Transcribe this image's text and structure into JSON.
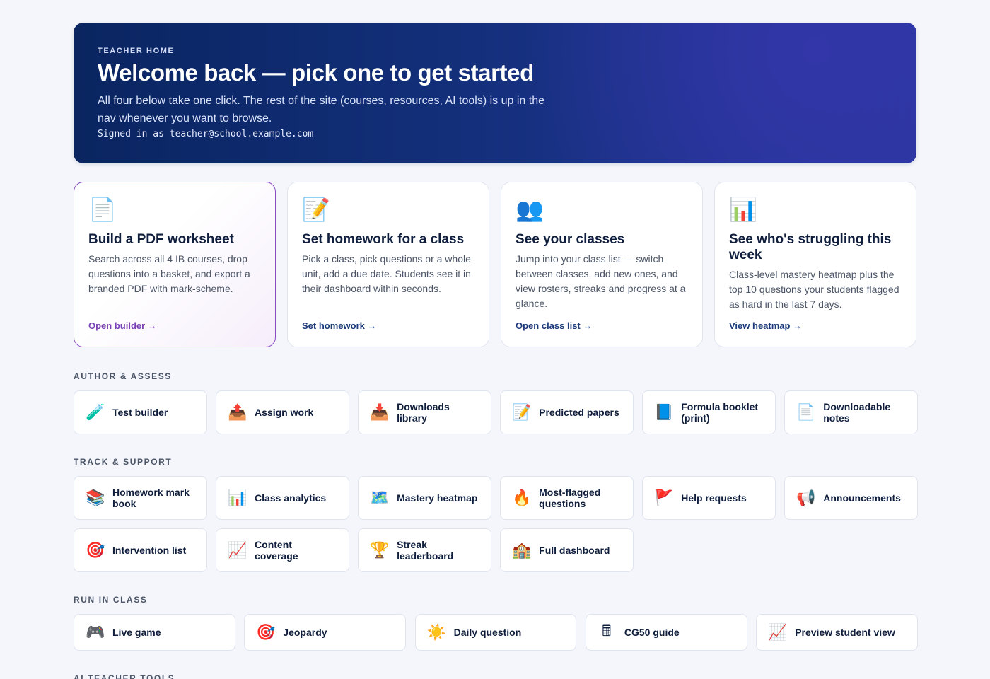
{
  "hero": {
    "eyebrow": "TEACHER HOME",
    "title": "Welcome back — pick one to get started",
    "subtitle": "All four below take one click. The rest of the site (courses, resources, AI tools) is up in the nav whenever you want to browse.",
    "signed_in": "Signed in as teacher@school.example.com"
  },
  "cards": [
    {
      "icon": "📄",
      "title": "Build a PDF worksheet",
      "desc": "Search across all 4 IB courses, drop questions into a basket, and export a branded PDF with mark-scheme.",
      "cta": "Open builder →"
    },
    {
      "icon": "📝",
      "title": "Set homework for a class",
      "desc": "Pick a class, pick questions or a whole unit, add a due date. Students see it in their dashboard within seconds.",
      "cta": "Set homework →"
    },
    {
      "icon": "👥",
      "title": "See your classes",
      "desc": "Jump into your class list — switch between classes, add new ones, and view rosters, streaks and progress at a glance.",
      "cta": "Open class list →"
    },
    {
      "icon": "📊",
      "title": "See who's struggling this week",
      "desc": "Class-level mastery heatmap plus the top 10 questions your students flagged as hard in the last 7 days.",
      "cta": "View heatmap →"
    }
  ],
  "sections": {
    "author": {
      "label": "AUTHOR & ASSESS",
      "items": [
        {
          "icon": "🧪",
          "label": "Test builder"
        },
        {
          "icon": "📤",
          "label": "Assign work"
        },
        {
          "icon": "📥",
          "label": "Downloads library"
        },
        {
          "icon": "📝",
          "label": "Predicted papers"
        },
        {
          "icon": "📘",
          "label": "Formula booklet (print)"
        },
        {
          "icon": "📄",
          "label": "Downloadable notes"
        }
      ]
    },
    "track": {
      "label": "TRACK & SUPPORT",
      "items": [
        {
          "icon": "📚",
          "label": "Homework mark book"
        },
        {
          "icon": "📊",
          "label": "Class analytics"
        },
        {
          "icon": "🗺️",
          "label": "Mastery heatmap"
        },
        {
          "icon": "🔥",
          "label": "Most-flagged questions"
        },
        {
          "icon": "🚩",
          "label": "Help requests"
        },
        {
          "icon": "📢",
          "label": "Announcements"
        },
        {
          "icon": "🎯",
          "label": "Intervention list"
        },
        {
          "icon": "📈",
          "label": "Content coverage"
        },
        {
          "icon": "🏆",
          "label": "Streak leaderboard"
        },
        {
          "icon": "🏫",
          "label": "Full dashboard"
        }
      ]
    },
    "run": {
      "label": "RUN IN CLASS",
      "items": [
        {
          "icon": "🎮",
          "label": "Live game"
        },
        {
          "icon": "🎯",
          "label": "Jeopardy"
        },
        {
          "icon": "☀️",
          "label": "Daily question"
        },
        {
          "icon": "🖩",
          "label": "CG50 guide"
        },
        {
          "icon": "📈",
          "label": "Preview student view"
        }
      ]
    },
    "ai": {
      "label": "AI TEACHER TOOLS"
    }
  }
}
